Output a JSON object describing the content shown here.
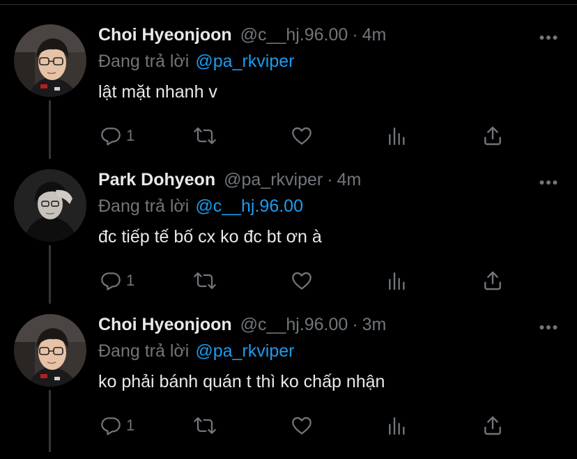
{
  "theme": {
    "background": "#000000",
    "text": "#e7e9ea",
    "secondary": "#71767b",
    "accent": "#1d9bf0",
    "thread_line": "#333639"
  },
  "tweets": [
    {
      "display_name": "Choi Hyeonjoon",
      "handle": "@c__hj.96.00",
      "separator": "·",
      "time": "4m",
      "reply_prefix": "Đang trả lời",
      "reply_mention": "@pa_rkviper",
      "text": "lật mặt nhanh v",
      "reply_count": "1",
      "avatar": "avatar-choi"
    },
    {
      "display_name": "Park Dohyeon",
      "handle": "@pa_rkviper",
      "separator": "·",
      "time": "4m",
      "reply_prefix": "Đang trả lời",
      "reply_mention": "@c__hj.96.00",
      "text": "đc tiếp tế bố cx ko đc bt ơn à",
      "reply_count": "1",
      "avatar": "avatar-park"
    },
    {
      "display_name": "Choi Hyeonjoon",
      "handle": "@c__hj.96.00",
      "separator": "·",
      "time": "3m",
      "reply_prefix": "Đang trả lời",
      "reply_mention": "@pa_rkviper",
      "text": "ko phải bánh quán t thì ko chấp nhận",
      "reply_count": "1",
      "avatar": "avatar-choi"
    }
  ],
  "icons": {
    "more": "more-horizontal-icon",
    "reply": "reply-icon",
    "retweet": "retweet-icon",
    "like": "heart-icon",
    "views": "analytics-icon",
    "share": "share-icon"
  }
}
